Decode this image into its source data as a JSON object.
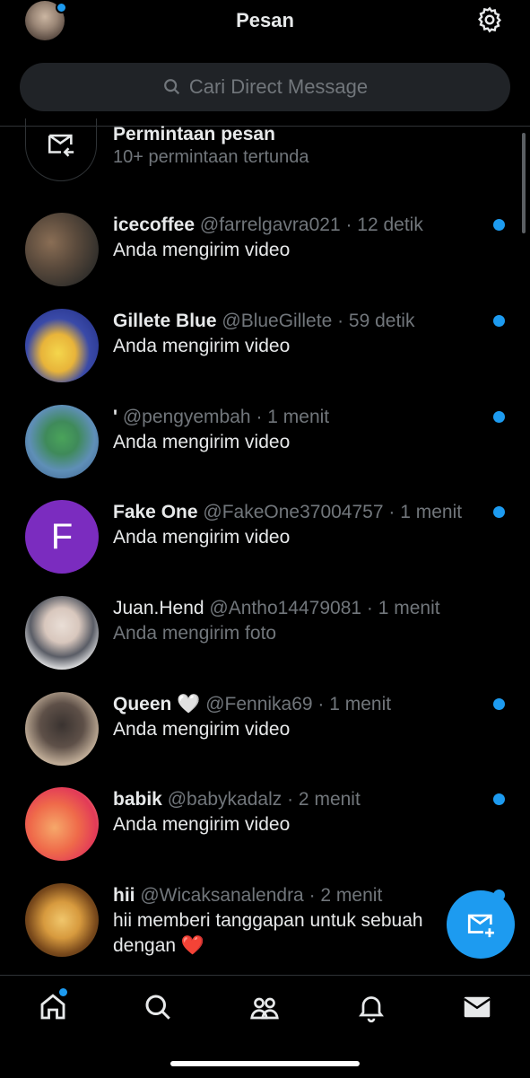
{
  "header": {
    "title": "Pesan"
  },
  "search": {
    "placeholder": "Cari Direct Message"
  },
  "requests": {
    "title": "Permintaan pesan",
    "subtitle": "10+ permintaan tertunda"
  },
  "conversations": [
    {
      "name": "icecoffee",
      "handle": "@farrelgavra021",
      "time": "· 12 detik",
      "message": "Anda mengirim video",
      "unread": true
    },
    {
      "name": "Gillete Blue",
      "handle": "@BlueGillete",
      "time": "· 59 detik",
      "message": "Anda mengirim video",
      "unread": true
    },
    {
      "name": "'",
      "handle": "@pengyembah",
      "time": "· 1 menit",
      "message": "Anda mengirim video",
      "unread": true
    },
    {
      "name": "Fake One",
      "handle": "@FakeOne37004757",
      "time": "· 1 menit",
      "message": "Anda mengirim video",
      "unread": true,
      "avatar_letter": "F",
      "avatar_color": "#7b2cbf"
    },
    {
      "name": "Juan.Hend",
      "handle": "@Antho14479081",
      "time": "· 1 menit",
      "message": "Anda mengirim foto",
      "unread": false
    },
    {
      "name": "Queen 🤍",
      "handle": "@Fennika69",
      "time": "· 1 menit",
      "message": "Anda mengirim video",
      "unread": true
    },
    {
      "name": "babik",
      "handle": "@babykadalz",
      "time": "· 2 menit",
      "message": "Anda mengirim video",
      "unread": true
    },
    {
      "name": "hii",
      "handle": "@Wicaksanalendra",
      "time": "· 2 menit",
      "message": "hii memberi tanggapan untuk sebuah",
      "message_line2": "dengan ❤️",
      "unread": true
    }
  ],
  "icons": {
    "profile": "avatar",
    "settings": "gear-icon",
    "search": "search-icon",
    "requests": "message-request-icon",
    "compose": "new-message-icon",
    "tabs": [
      "home-icon",
      "search-icon",
      "communities-icon",
      "bell-icon",
      "mail-icon"
    ]
  },
  "colors": {
    "accent": "#1d9bf0",
    "muted": "#71767b",
    "background": "#000000"
  }
}
